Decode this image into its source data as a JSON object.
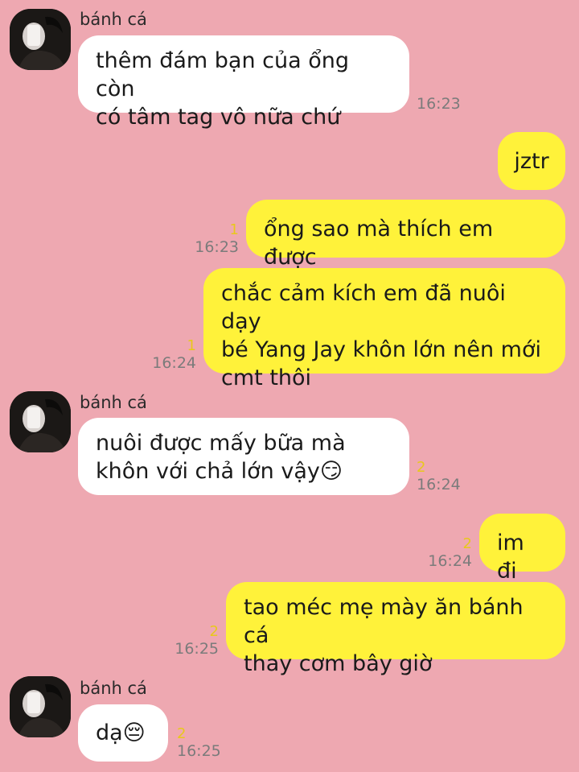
{
  "contact": {
    "name": "bánh cá",
    "avatar_icon": "profile-photo-icon"
  },
  "messages": [
    {
      "from": "them",
      "text": "thêm đám bạn của ổng còn\ncó tâm tag vô nữa chứ",
      "time": "16:23",
      "unread": ""
    },
    {
      "from": "me",
      "text": "jztr",
      "time": "",
      "unread": ""
    },
    {
      "from": "me",
      "text": "ổng sao mà thích em được",
      "time": "16:23",
      "unread": "1"
    },
    {
      "from": "me",
      "text": "chắc cảm kích em đã nuôi dạy\nbé Yang Jay khôn lớn nên mới\ncmt thôi",
      "time": "16:24",
      "unread": "1"
    },
    {
      "from": "them",
      "text": "nuôi được mấy bữa mà\nkhôn với chả lớn vậy😏",
      "time": "16:24",
      "unread": "2"
    },
    {
      "from": "me",
      "text": "im đi",
      "time": "16:24",
      "unread": "2"
    },
    {
      "from": "me",
      "text": "tao méc mẹ mày ăn bánh cá\nthay cơm bây giờ",
      "time": "16:25",
      "unread": "2"
    },
    {
      "from": "them",
      "text": "dạ😔",
      "time": "16:25",
      "unread": "2"
    }
  ],
  "colors": {
    "background": "#eea8b1",
    "incoming_bubble": "#ffffff",
    "outgoing_bubble": "#fff23a",
    "unread_count": "#e8c81c",
    "timestamp": "#7b7b7b"
  }
}
